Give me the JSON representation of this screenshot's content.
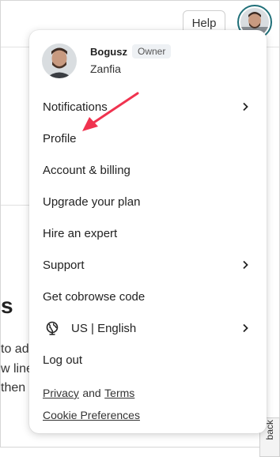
{
  "header": {
    "help_label": "Help"
  },
  "background": {
    "heading": "s",
    "lines": [
      "to ad",
      "w line",
      "then"
    ]
  },
  "feedback_tab": {
    "label": "back"
  },
  "menu": {
    "user": {
      "name": "Bogusz",
      "role_badge": "Owner",
      "organization": "Zanfia"
    },
    "items": [
      {
        "label": "Notifications",
        "has_submenu": true
      },
      {
        "label": "Profile",
        "has_submenu": false
      },
      {
        "label": "Account & billing",
        "has_submenu": false
      },
      {
        "label": "Upgrade your plan",
        "has_submenu": false
      },
      {
        "label": "Hire an expert",
        "has_submenu": false
      },
      {
        "label": "Support",
        "has_submenu": true
      },
      {
        "label": "Get cobrowse code",
        "has_submenu": false
      },
      {
        "label": "US | English",
        "has_submenu": true,
        "icon": "globe-icon"
      },
      {
        "label": "Log out",
        "has_submenu": false
      }
    ],
    "footer": {
      "privacy_label": "Privacy",
      "and_label": "and",
      "terms_label": "Terms",
      "cookie_label": "Cookie Preferences"
    }
  },
  "colors": {
    "annotation_arrow": "#f0334f",
    "avatar_ring": "#1f6f78",
    "badge_bg": "#eef1f4"
  }
}
